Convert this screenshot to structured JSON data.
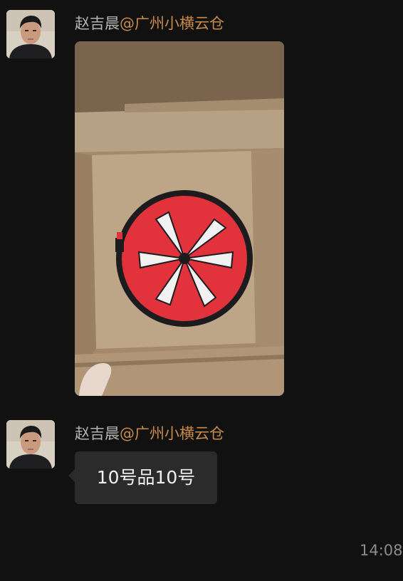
{
  "messages": [
    {
      "sender_name": "赵吉晨",
      "sender_org": "@广州小横云仓",
      "type": "image",
      "image_alt": "product-photo"
    },
    {
      "sender_name": "赵吉晨",
      "sender_org": "@广州小横云仓",
      "type": "text",
      "text": "10号品10号"
    }
  ],
  "timestamp": "14:08",
  "colors": {
    "background": "#111111",
    "name": "#b4b4b4",
    "org": "#c98a4a",
    "bubble": "#2b2b2b",
    "timestamp": "#8b8b8b"
  }
}
